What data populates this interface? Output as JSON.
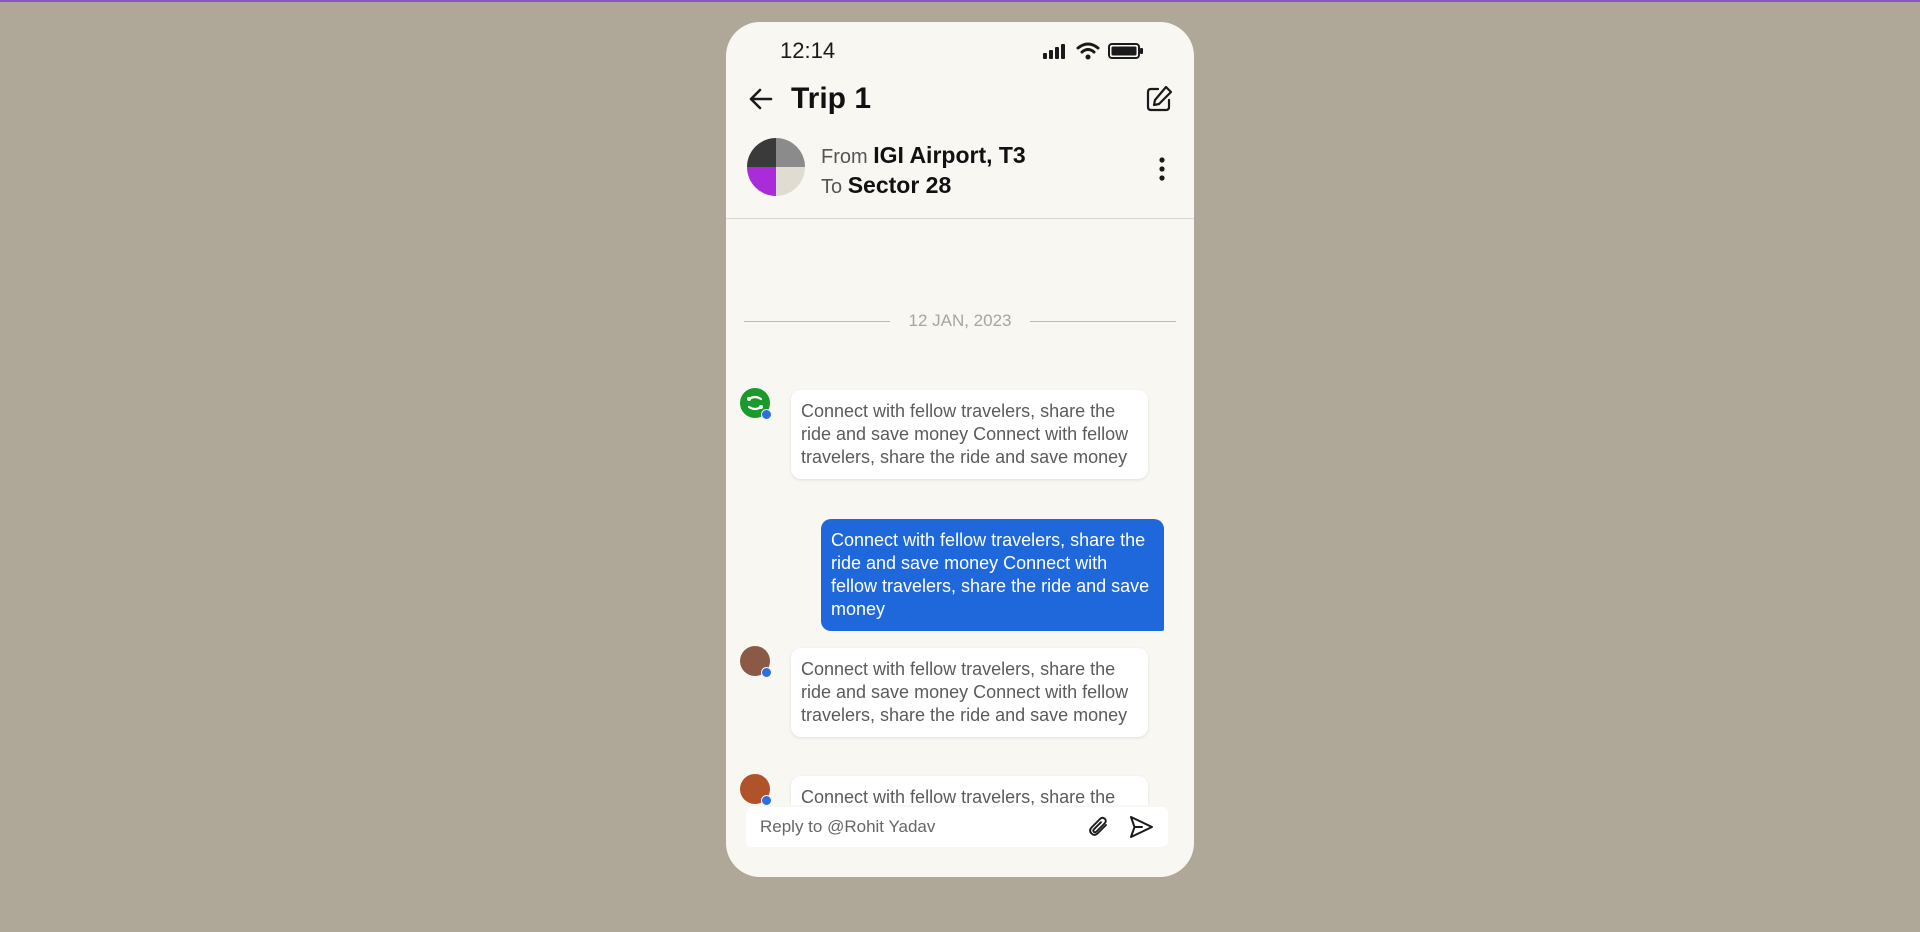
{
  "status_bar": {
    "time": "12:14"
  },
  "header": {
    "title": "Trip 1"
  },
  "route": {
    "from_label": "From",
    "from_value": "IGI Airport, T3",
    "to_label": "To",
    "to_value": "Sector 28"
  },
  "date_separator": "12 JAN, 2023",
  "messages": [
    {
      "direction": "incoming",
      "text": "Connect with fellow travelers, share the ride and save money Connect with fellow travelers, share the ride and save money"
    },
    {
      "direction": "outgoing",
      "text": "Connect with fellow travelers, share the ride and save money Connect with fellow travelers, share the ride and save money"
    },
    {
      "direction": "incoming",
      "text": "Connect with fellow travelers, share the ride and save money Connect with fellow travelers, share the ride and save money"
    },
    {
      "direction": "incoming",
      "text": "Connect with fellow travelers, share the ride and save money Connect with fellow travelers, share the ride and save money"
    }
  ],
  "composer": {
    "placeholder": "Reply to @Rohit Yadav"
  },
  "colors": {
    "background": "#afa797",
    "phone": "#f9f7f2",
    "outgoing_bubble": "#1f68dc"
  }
}
